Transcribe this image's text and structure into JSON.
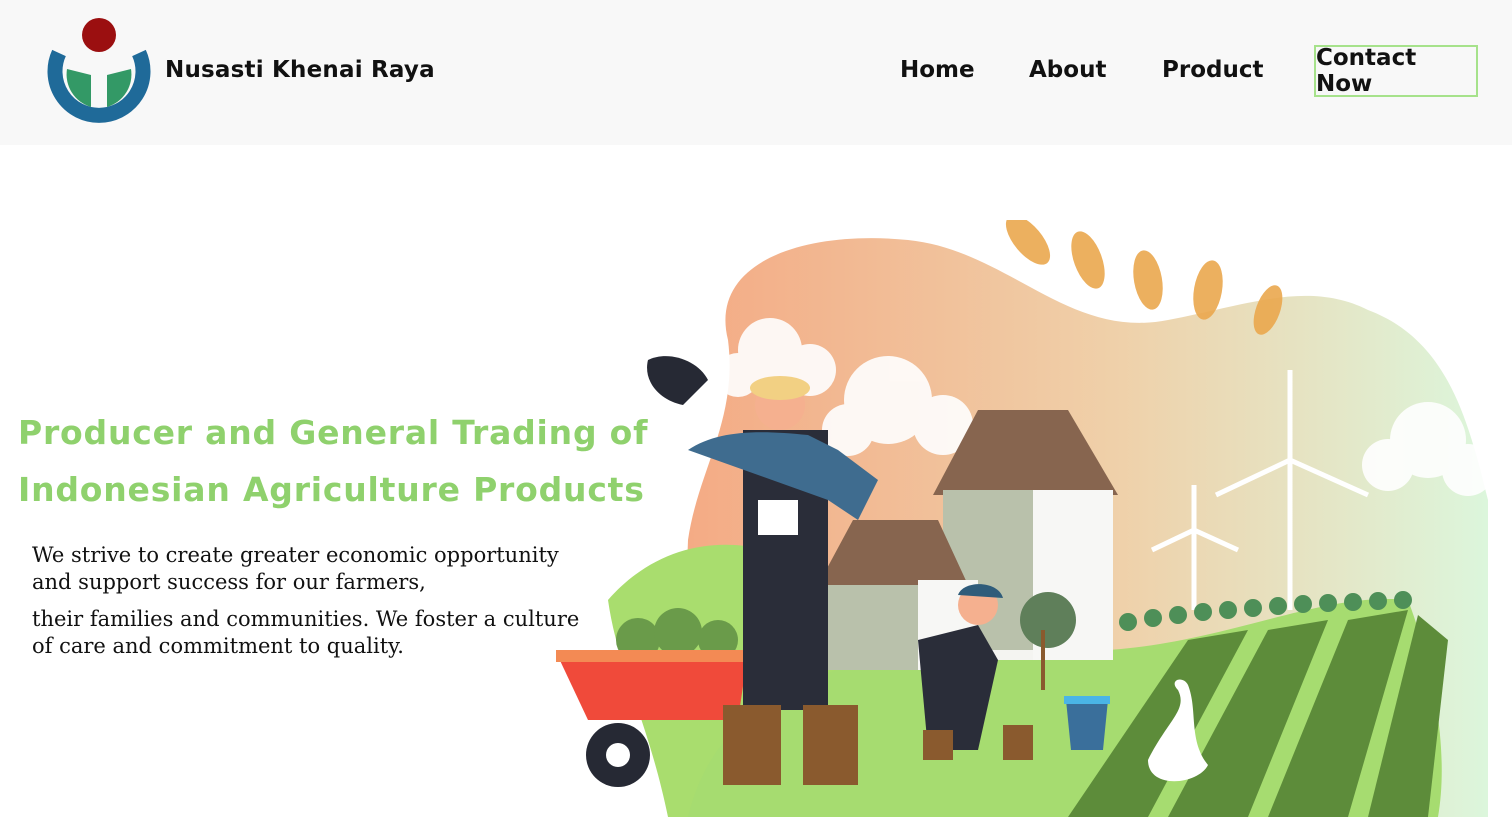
{
  "header": {
    "brand": "Nusasti Khenai Raya",
    "logo_icon": "wikimedia-style-logo",
    "nav": [
      {
        "label": "Home"
      },
      {
        "label": "About"
      },
      {
        "label": "Product"
      }
    ],
    "contact_label": "Contact Now"
  },
  "hero": {
    "title_line1": "Producer and General Trading of",
    "title_line2": "Indonesian Agriculture Products",
    "paragraph1": "We strive to create greater economic opportunity and support success for our farmers,",
    "paragraph2": "their families and communities. We foster a culture of care and commitment to quality.",
    "illustration": "farmers-field-illustration"
  },
  "colors": {
    "accent_green": "#8fd16d",
    "contact_border": "#a6e28b",
    "header_bg": "#f8f8f8"
  }
}
